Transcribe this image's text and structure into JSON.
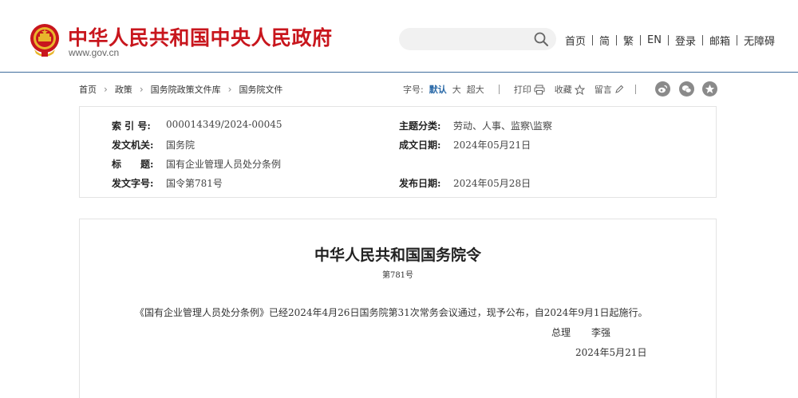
{
  "header": {
    "site_title": "中华人民共和国中央人民政府",
    "site_url": "www.gov.cn",
    "search": {
      "value": "",
      "placeholder": ""
    },
    "nav": [
      "首页",
      "简",
      "繁",
      "EN",
      "登录",
      "邮箱",
      "无障碍"
    ]
  },
  "breadcrumb": [
    "首页",
    "政策",
    "国务院政策文件库",
    "国务院文件"
  ],
  "toolbar": {
    "font_size_label": "字号:",
    "font_default": "默认",
    "font_large": "大",
    "font_xlarge": "超大",
    "print_label": "打印",
    "favorite_label": "收藏",
    "comment_label": "留言"
  },
  "share_icons": [
    "weibo-icon",
    "wechat-icon",
    "qzone-icon"
  ],
  "info": {
    "index_label": "索 引 号:",
    "index_value": "000014349/2024-00045",
    "topic_label": "主题分类:",
    "topic_value": "劳动、人事、监察\\监察",
    "issuer_label": "发文机关:",
    "issuer_value": "国务院",
    "written_label": "成文日期:",
    "written_value": "2024年05月21日",
    "title_label": "标　　题:",
    "title_value": "国有企业管理人员处分条例",
    "docno_label": "发文字号:",
    "docno_value": "国令第781号",
    "published_label": "发布日期:",
    "published_value": "2024年05月28日"
  },
  "document": {
    "title": "中华人民共和国国务院令",
    "number": "第781号",
    "body": "《国有企业管理人员处分条例》已经2024年4月26日国务院第31次常务会议通过，现予公布，自2024年9月1日起施行。",
    "signer_title": "总理",
    "signer_name": "李强",
    "date": "2024年5月21日"
  },
  "colors": {
    "brand_red": "#c8161d",
    "rule_blue": "#3f6d9c",
    "active_blue": "#2b6aa8"
  }
}
